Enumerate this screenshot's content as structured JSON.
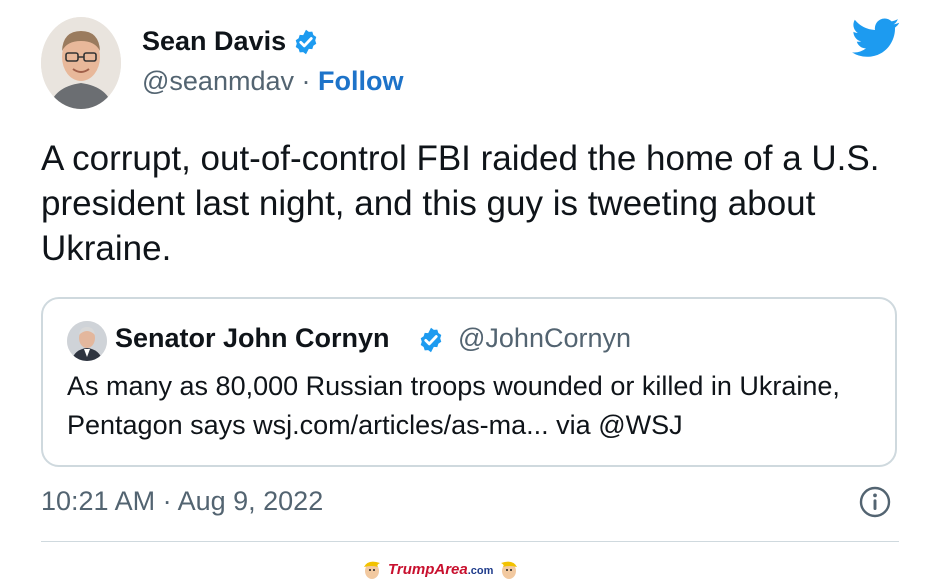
{
  "tweet": {
    "author_name": "Sean Davis",
    "author_handle": "@seanmdav",
    "separator": " · ",
    "follow_label": "Follow",
    "text": "A corrupt, out-of-control FBI raided the home of a U.S. president last night, and this guy is tweeting about Ukraine.",
    "timestamp": "10:21 AM · Aug 9, 2022"
  },
  "quoted_tweet": {
    "author_name": "Senator John Cornyn",
    "author_handle": "@JohnCornyn",
    "text": "As many as 80,000 Russian troops wounded or killed in Ukraine, Pentagon says  wsj.com/articles/as-ma... via @WSJ"
  },
  "watermark": {
    "brand_main": "TrumpArea",
    "brand_suffix": ".com"
  },
  "colors": {
    "twitter_blue": "#1d9bf0",
    "follow_blue": "#1d73c9",
    "secondary_text": "#536471",
    "border": "#cfd9de"
  },
  "icons": [
    "avatar",
    "verified-badge-icon",
    "twitter-bird-icon",
    "info-icon",
    "trump-cartoon-icon"
  ]
}
